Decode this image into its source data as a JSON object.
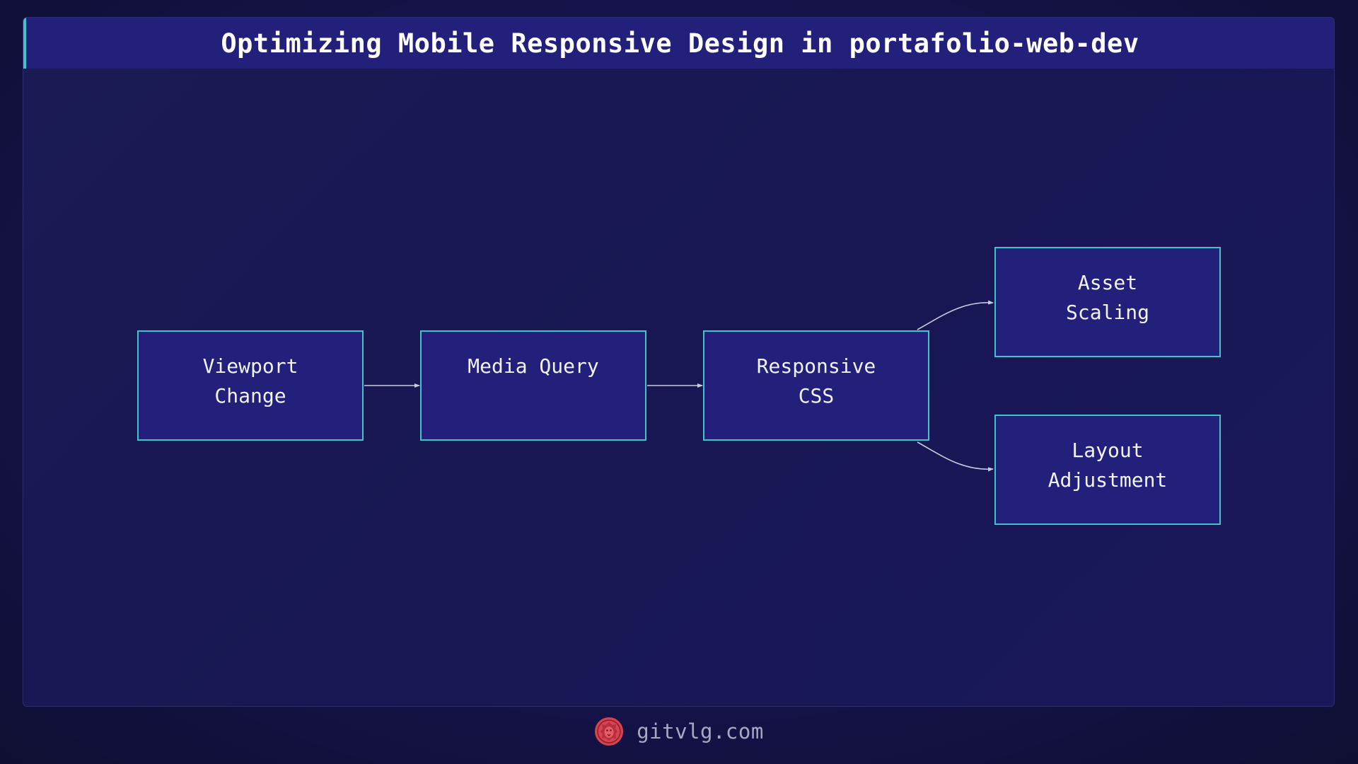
{
  "title": "Optimizing Mobile Responsive Design in portafolio-web-dev",
  "nodes": {
    "viewport_change": "Viewport\nChange",
    "media_query": "Media Query",
    "responsive_css": "Responsive\nCSS",
    "asset_scaling": "Asset\nScaling",
    "layout_adjustment": "Layout\nAdjustment"
  },
  "edges": [
    {
      "from": "Viewport Change",
      "to": "Media Query"
    },
    {
      "from": "Media Query",
      "to": "Responsive CSS"
    },
    {
      "from": "Responsive CSS",
      "to": "Asset Scaling"
    },
    {
      "from": "Responsive CSS",
      "to": "Layout Adjustment"
    }
  ],
  "footer": {
    "site": "gitvlg.com",
    "logo_icon": "lion-logo-icon"
  },
  "colors": {
    "background": "#15134a",
    "node_fill": "#22207a",
    "node_border": "#3fc5c8",
    "accent": "#3fc5c8",
    "logo": "#d9434f"
  }
}
